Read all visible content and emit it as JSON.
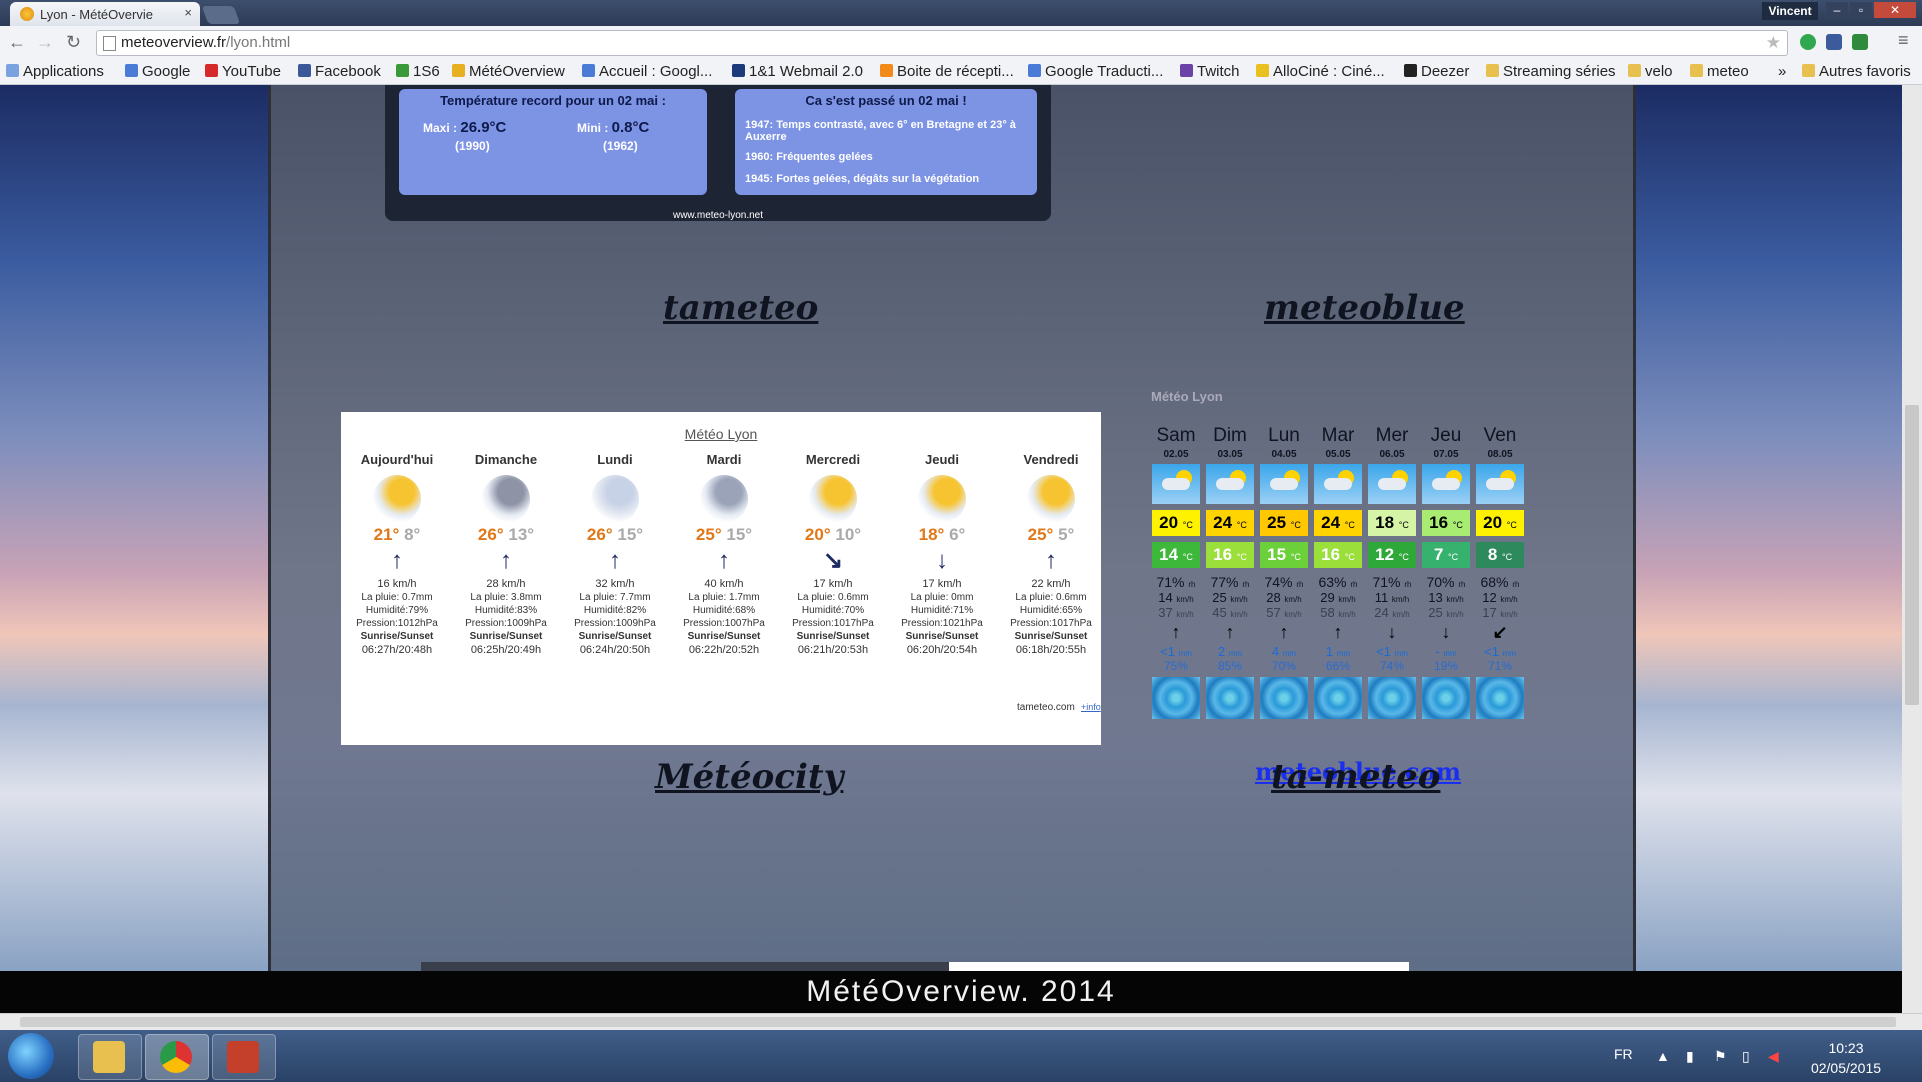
{
  "browser": {
    "tab_title": "Lyon - MétéOvervie",
    "tab_close": "×",
    "user": "Vincent",
    "url_host": "meteoverview.fr",
    "url_path": "/lyon.html",
    "win_min": "–",
    "win_max": "▫",
    "win_close": "✕",
    "bookmarks": [
      "Applications",
      "Google",
      "YouTube",
      "Facebook",
      "1S6",
      "MétéOverview",
      "Accueil : Googl...",
      "1&1 Webmail 2.0",
      "Boite de récepti...",
      "Google Traducti...",
      "Twitch",
      "AlloCiné : Ciné...",
      "Deezer",
      "Streaming séries",
      "velo",
      "meteo",
      "»",
      "Autres favoris"
    ]
  },
  "record": {
    "title_left": "Température record pour un 02 mai :",
    "maxi_label": "Maxi :",
    "maxi_value": "26.9°C",
    "maxi_year": "(1990)",
    "mini_label": "Mini :",
    "mini_value": "0.8°C",
    "mini_year": "(1962)",
    "title_right": "Ca s'est passé un 02 mai !",
    "events": [
      "1947: Temps contrasté, avec 6° en Bretagne et 23° à Auxerre",
      "1960: Fréquentes gelées",
      "1945: Fortes gelées, dégâts sur la végétation"
    ],
    "footer": "www.meteo-lyon.net"
  },
  "sections": {
    "tameteo": "tameteo",
    "meteoblue": "meteoblue",
    "meteocity": "Météocity",
    "tameteo2": "ta-meteo"
  },
  "tameteo": {
    "title": "Météo Lyon",
    "days": [
      {
        "day": "Aujourd'hui",
        "hi": "21°",
        "lo": "8°",
        "arrow": "↑",
        "wind": "16 km/h",
        "rain": "La pluie: 0.7mm",
        "hum": "Humidité:79%",
        "press": "Pression:1012hPa",
        "ss": "Sunrise/Sunset",
        "times": "06:27h/20:48h"
      },
      {
        "day": "Dimanche",
        "hi": "26°",
        "lo": "13°",
        "arrow": "↑",
        "wind": "28 km/h",
        "rain": "La pluie: 3.8mm",
        "hum": "Humidité:83%",
        "press": "Pression:1009hPa",
        "ss": "Sunrise/Sunset",
        "times": "06:25h/20:49h"
      },
      {
        "day": "Lundi",
        "hi": "26°",
        "lo": "15°",
        "arrow": "↑",
        "wind": "32 km/h",
        "rain": "La pluie: 7.7mm",
        "hum": "Humidité:82%",
        "press": "Pression:1009hPa",
        "ss": "Sunrise/Sunset",
        "times": "06:24h/20:50h"
      },
      {
        "day": "Mardi",
        "hi": "25°",
        "lo": "15°",
        "arrow": "↑",
        "wind": "40 km/h",
        "rain": "La pluie: 1.7mm",
        "hum": "Humidité:68%",
        "press": "Pression:1007hPa",
        "ss": "Sunrise/Sunset",
        "times": "06:22h/20:52h"
      },
      {
        "day": "Mercredi",
        "hi": "20°",
        "lo": "10°",
        "arrow": "↘",
        "wind": "17 km/h",
        "rain": "La pluie: 0.6mm",
        "hum": "Humidité:70%",
        "press": "Pression:1017hPa",
        "ss": "Sunrise/Sunset",
        "times": "06:21h/20:53h"
      },
      {
        "day": "Jeudi",
        "hi": "18°",
        "lo": "6°",
        "arrow": "↓",
        "wind": "17 km/h",
        "rain": "La pluie: 0mm",
        "hum": "Humidité:71%",
        "press": "Pression:1021hPa",
        "ss": "Sunrise/Sunset",
        "times": "06:20h/20:54h"
      },
      {
        "day": "Vendredi",
        "hi": "25°",
        "lo": "5°",
        "arrow": "↑",
        "wind": "22 km/h",
        "rain": "La pluie: 0.6mm",
        "hum": "Humidité:65%",
        "press": "Pression:1017hPa",
        "ss": "Sunrise/Sunset",
        "times": "06:18h/20:55h"
      }
    ],
    "footer": "tameteo.com",
    "info": "+info"
  },
  "meteoblue": {
    "title": "Météo Lyon",
    "link": "meteoblue.com",
    "days": [
      {
        "day": "Sam",
        "date": "02.05",
        "max": "20",
        "min": "14",
        "hum": "71%",
        "wind": "14",
        "gust": "37",
        "arrow": "↑",
        "rain": "<1",
        "prob": "75%",
        "maxColor": "#fff200",
        "minColor": "#3db83a"
      },
      {
        "day": "Dim",
        "date": "03.05",
        "max": "24",
        "min": "16",
        "hum": "77%",
        "wind": "25",
        "gust": "45",
        "arrow": "↑",
        "rain": "2",
        "prob": "85%",
        "maxColor": "#ffd400",
        "minColor": "#9adf3a"
      },
      {
        "day": "Lun",
        "date": "04.05",
        "max": "25",
        "min": "15",
        "hum": "74%",
        "wind": "28",
        "gust": "57",
        "arrow": "↑",
        "rain": "4",
        "prob": "70%",
        "maxColor": "#ffc800",
        "minColor": "#6cd03a"
      },
      {
        "day": "Mar",
        "date": "05.05",
        "max": "24",
        "min": "16",
        "hum": "63%",
        "wind": "29",
        "gust": "58",
        "arrow": "↑",
        "rain": "1",
        "prob": "66%",
        "maxColor": "#ffd400",
        "minColor": "#9adf3a"
      },
      {
        "day": "Mer",
        "date": "06.05",
        "max": "18",
        "min": "12",
        "hum": "71%",
        "wind": "11",
        "gust": "24",
        "arrow": "↓",
        "rain": "<1",
        "prob": "74%",
        "maxColor": "#d6f4a6",
        "minColor": "#2fa83a"
      },
      {
        "day": "Jeu",
        "date": "07.05",
        "max": "16",
        "min": "7",
        "hum": "70%",
        "wind": "13",
        "gust": "25",
        "arrow": "↓",
        "rain": "-",
        "prob": "19%",
        "maxColor": "#a8ec72",
        "minColor": "#36b26e"
      },
      {
        "day": "Ven",
        "date": "08.05",
        "max": "20",
        "min": "8",
        "hum": "68%",
        "wind": "12",
        "gust": "17",
        "arrow": "↙",
        "rain": "<1",
        "prob": "71%",
        "maxColor": "#fff200",
        "minColor": "#2e8a5c"
      }
    ],
    "units": {
      "temp": "°C",
      "hum": "rh",
      "wind": "km/h",
      "rain": "mm"
    }
  },
  "footer": "MétéOverview. 2014",
  "taskbar": {
    "lang": "FR",
    "time": "10:23",
    "date": "02/05/2015"
  }
}
